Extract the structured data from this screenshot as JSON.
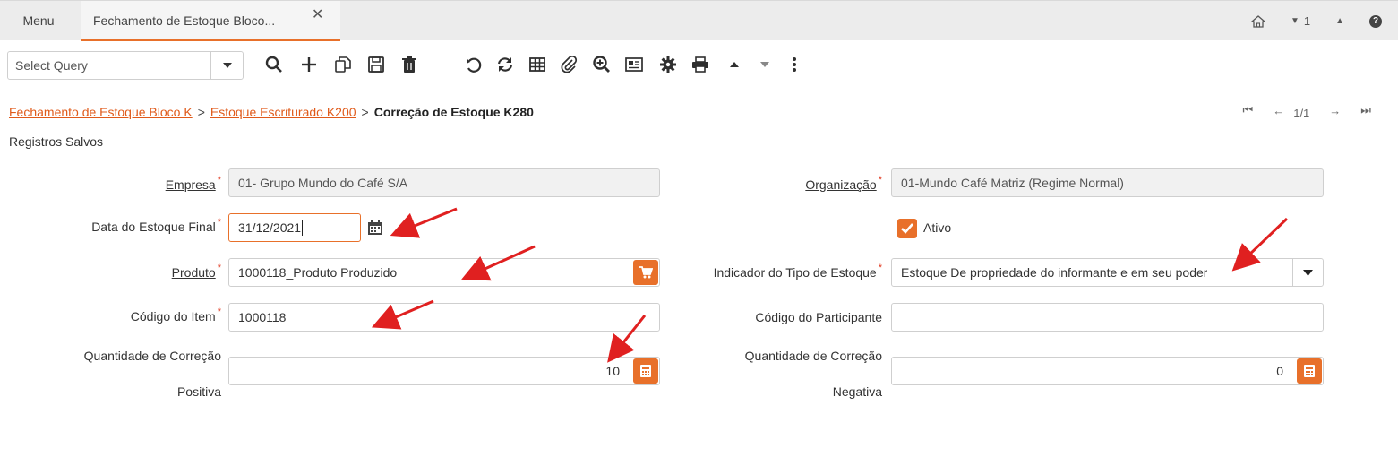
{
  "tabs": {
    "menu_label": "Menu",
    "active_label": "Fechamento de Estoque Bloco...",
    "close_glyph": "✕",
    "counter": "1"
  },
  "toolbar": {
    "query_placeholder": "Select Query"
  },
  "breadcrumb": {
    "items": [
      "Fechamento de Estoque Bloco K",
      "Estoque Escriturado K200"
    ],
    "separator": ">",
    "current": "Correção de Estoque K280"
  },
  "pager": {
    "page": "1/1"
  },
  "section": {
    "title": "Registros Salvos"
  },
  "form": {
    "empresa_label": "Empresa",
    "empresa_value": "01- Grupo Mundo do Café S/A",
    "organizacao_label": "Organização",
    "organizacao_value": "01-Mundo Café Matriz (Regime Normal)",
    "data_label": "Data do Estoque Final",
    "data_value": "31/12/2021",
    "ativo_label": "Ativo",
    "produto_label": "Produto",
    "produto_value": "1000118_Produto Produzido",
    "indicador_label": "Indicador do Tipo de Estoque",
    "indicador_value": "Estoque De propriedade do informante e em seu poder",
    "codigo_item_label": "Código do Item",
    "codigo_item_value": "1000118",
    "codigo_part_label": "Código do Participante",
    "codigo_part_value": "",
    "qtd_pos_label_1": "Quantidade de Correção",
    "qtd_pos_label_2": "Positiva",
    "qtd_pos_value": "10",
    "qtd_neg_label_1": "Quantidade de Correção",
    "qtd_neg_label_2": "Negativa",
    "qtd_neg_value": "0"
  },
  "colors": {
    "accent": "#e8702a",
    "link": "#e05a1a",
    "required": "#e0341a",
    "annotation_arrow": "#e02020"
  }
}
